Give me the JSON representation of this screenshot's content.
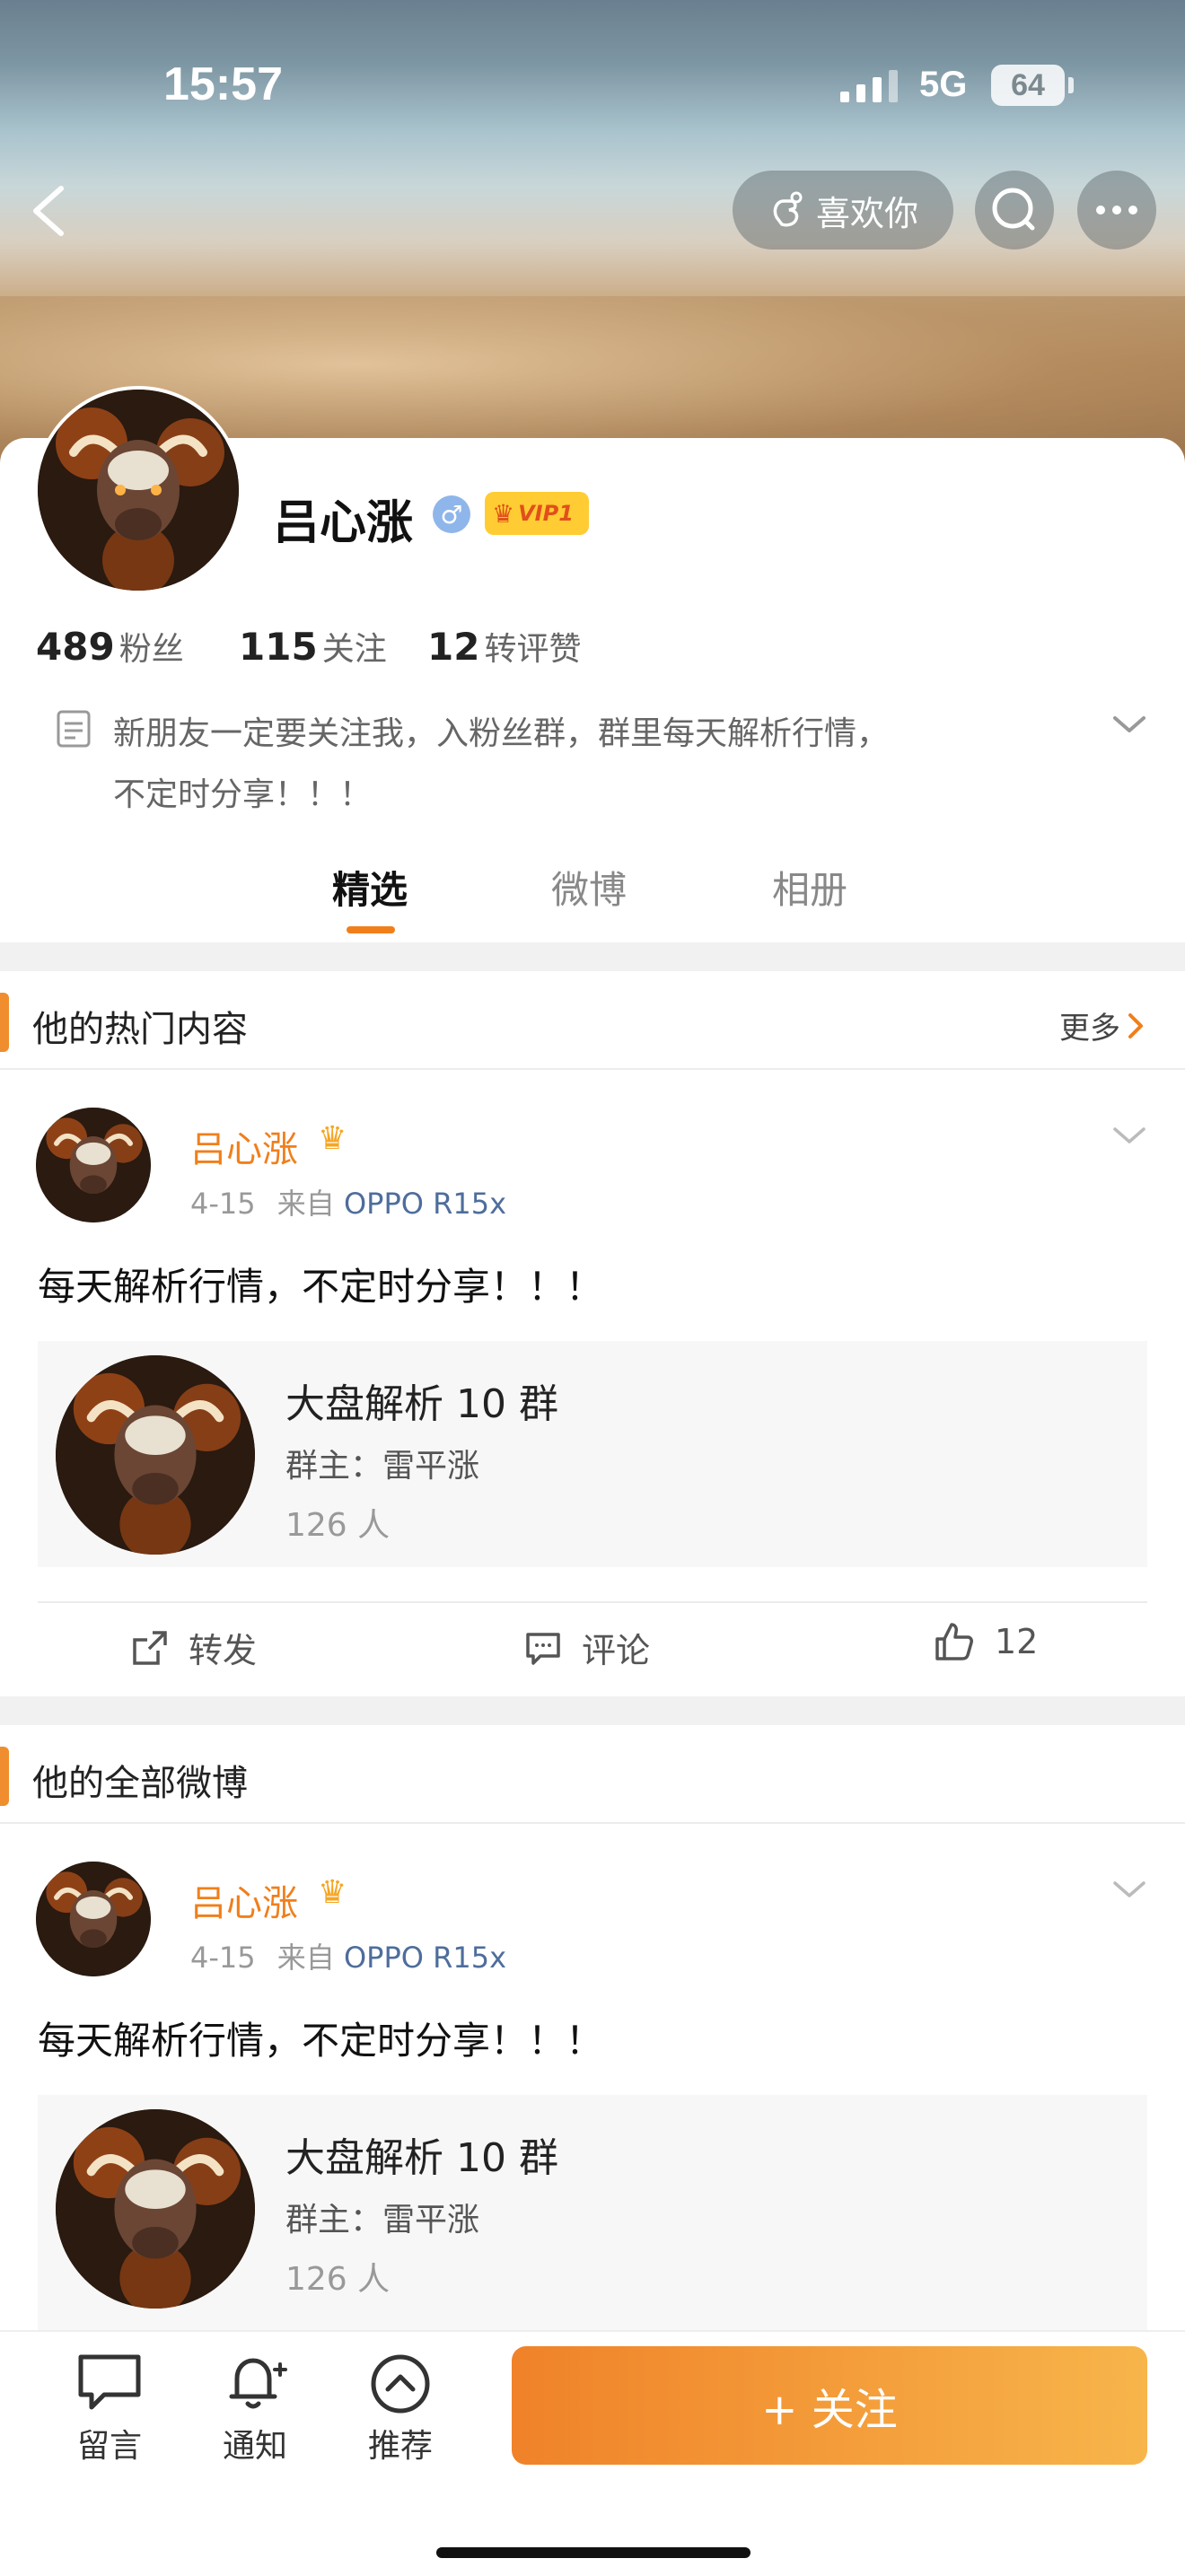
{
  "status_bar": {
    "time": "15:57",
    "network": "5G",
    "battery": "64"
  },
  "nav": {
    "like_you_label": "喜欢你"
  },
  "profile": {
    "name": "吕心涨",
    "vip_badge": "VIP1",
    "stats": [
      {
        "num": "489",
        "label": "粉丝"
      },
      {
        "num": "115",
        "label": "关注"
      },
      {
        "num": "12",
        "label": "转评赞"
      }
    ],
    "bio_line1": "新朋友一定要关注我，入粉丝群，群里每天解析行情，",
    "bio_line2": "不定时分享！！！"
  },
  "tabs": [
    "精选",
    "微博",
    "相册"
  ],
  "hot_section": {
    "title": "他的热门内容",
    "more_label": "更多",
    "post": {
      "author": "吕心涨",
      "date": "4-15",
      "source_prefix": "来自",
      "source": "OPPO R15x",
      "text": "每天解析行情，不定时分享！！！",
      "group": {
        "name": "大盘解析 10 群",
        "owner": "群主：雷平涨",
        "count": "126 人"
      },
      "actions": {
        "repost": "转发",
        "comment": "评论",
        "like": "12"
      }
    }
  },
  "all_section": {
    "title": "他的全部微博",
    "post": {
      "author": "吕心涨",
      "date": "4-15",
      "source_prefix": "来自",
      "source": "OPPO R15x",
      "text": "每天解析行情，不定时分享！！！",
      "group": {
        "name": "大盘解析 10 群",
        "owner": "群主：雷平涨",
        "count": "126 人"
      }
    }
  },
  "bottom_bar": {
    "message": "留言",
    "notify": "通知",
    "recommend": "推荐",
    "follow": "+ 关注"
  },
  "colors": {
    "accent": "#f07f1b",
    "link": "#4e6d9c",
    "follow_start": "#f08229",
    "follow_end": "#f7b54a"
  }
}
